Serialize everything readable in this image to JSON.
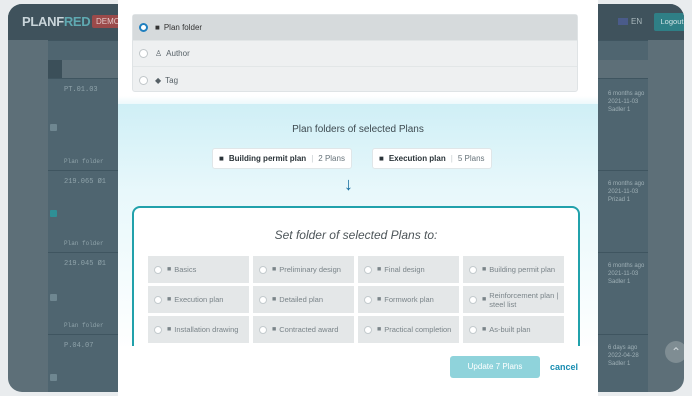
{
  "app": {
    "logo_a": "PLANF",
    "logo_b": "RED",
    "demo_badge": "DEMO",
    "lang": "EN",
    "logout": "Logout"
  },
  "background": {
    "rows": [
      {
        "id": "PT.01.03",
        "label": "Plan folder"
      },
      {
        "id": "219.065 Ø1",
        "label": "Plan folder"
      },
      {
        "id": "219.045 Ø1",
        "label": "Plan folder"
      },
      {
        "id": "P.04.07",
        "label": "Plan folder"
      }
    ],
    "right_items": [
      {
        "time": "6 months ago",
        "date": "2021-11-03",
        "who": "Sadler 1"
      },
      {
        "time": "6 months ago",
        "date": "2021-11-03",
        "who": "Prizad 1"
      },
      {
        "time": "6 months ago",
        "date": "2021-11-03",
        "who": "Sadler 1"
      },
      {
        "time": "6 days ago",
        "date": "2022-04-28",
        "who": "Sadler 1"
      }
    ]
  },
  "options": [
    {
      "label": "Plan folder",
      "icon": "folder-icon",
      "selected": true
    },
    {
      "label": "Author",
      "icon": "user-icon",
      "selected": false
    },
    {
      "label": "Tag",
      "icon": "tag-icon",
      "selected": false
    }
  ],
  "plan_folders": {
    "title": "Plan folders of selected Plans",
    "items": [
      {
        "name": "Building permit plan",
        "count": "2 Plans"
      },
      {
        "name": "Execution plan",
        "count": "5 Plans"
      }
    ]
  },
  "set_folder": {
    "title": "Set folder of selected Plans to:",
    "folders": [
      "Basics",
      "Preliminary design",
      "Final design",
      "Building permit plan",
      "Execution plan",
      "Detailed plan",
      "Formwork plan",
      "Reinforcement plan | steel list",
      "Installation drawing",
      "Contracted award",
      "Practical completion",
      "As-built plan"
    ]
  },
  "footer": {
    "update_label": "Update 7 Plans",
    "cancel_label": "cancel"
  },
  "colors": {
    "accent": "#21a1ab",
    "link": "#178cb1",
    "radio_on": "#1f7fbf"
  }
}
